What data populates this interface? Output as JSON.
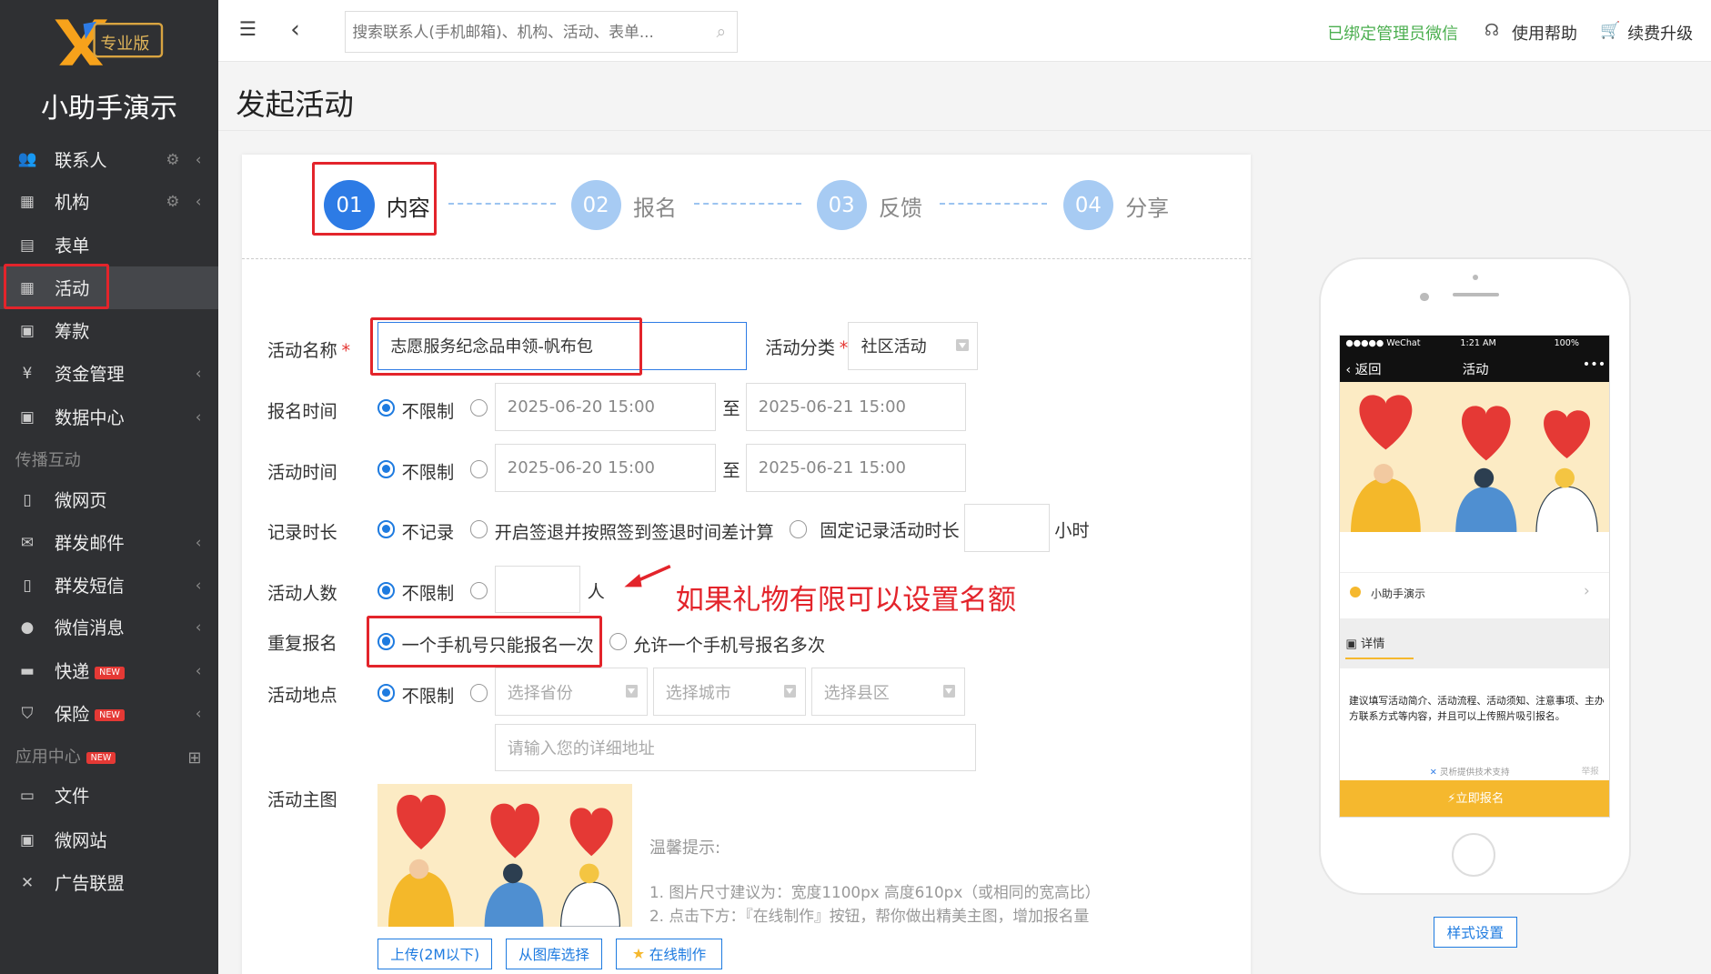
{
  "app": {
    "edition_badge": "专业版",
    "brand_name": "小助手演示"
  },
  "sidebar": {
    "items": [
      {
        "label": "联系人",
        "icon": "contacts-icon"
      },
      {
        "label": "机构",
        "icon": "building-icon"
      },
      {
        "label": "表单",
        "icon": "form-icon"
      },
      {
        "label": "活动",
        "icon": "calendar-icon"
      },
      {
        "label": "筹款",
        "icon": "fundraise-icon"
      },
      {
        "label": "资金管理",
        "icon": "yen-icon"
      },
      {
        "label": "数据中心",
        "icon": "data-icon"
      },
      {
        "label": "微网页",
        "icon": "page-icon"
      },
      {
        "label": "群发邮件",
        "icon": "mail-icon"
      },
      {
        "label": "群发短信",
        "icon": "phone-icon"
      },
      {
        "label": "微信消息",
        "icon": "wechat-icon"
      },
      {
        "label": "快递",
        "icon": "truck-icon"
      },
      {
        "label": "保险",
        "icon": "shield-icon"
      },
      {
        "label": "文件",
        "icon": "folder-icon"
      },
      {
        "label": "微网站",
        "icon": "site-icon"
      },
      {
        "label": "广告联盟",
        "icon": "ad-icon"
      }
    ],
    "section_broadcast": "传播互动",
    "section_apps": "应用中心",
    "new_badge": "NEW"
  },
  "topbar": {
    "search_placeholder": "搜索联系人(手机邮箱)、机构、活动、表单...",
    "bound_wechat": "已绑定管理员微信",
    "help": "使用帮助",
    "renew": "续费升级"
  },
  "page": {
    "title": "发起活动"
  },
  "steps": [
    {
      "num": "01",
      "label": "内容"
    },
    {
      "num": "02",
      "label": "报名"
    },
    {
      "num": "03",
      "label": "反馈"
    },
    {
      "num": "04",
      "label": "分享"
    }
  ],
  "form": {
    "name_label": "活动名称",
    "name_value": "志愿服务纪念品申领-帆布包",
    "category_label": "活动分类",
    "category_value": "社区活动",
    "reg_time_label": "报名时间",
    "unlimited": "不限制",
    "to": "至",
    "start": "2025-06-20 15:00",
    "end": "2025-06-21 15:00",
    "act_time_label": "活动时间",
    "record_label": "记录时长",
    "no_record": "不记录",
    "record_opt2": "开启签退并按照签到签退时间差计算",
    "record_opt3": "固定记录活动时长",
    "hours": "小时",
    "count_label": "活动人数",
    "people": "人",
    "annotation": "如果礼物有限可以设置名额",
    "repeat_label": "重复报名",
    "repeat_opt1": "一个手机号只能报名一次",
    "repeat_opt2": "允许一个手机号报名多次",
    "place_label": "活动地点",
    "province": "选择省份",
    "city": "选择城市",
    "district": "选择县区",
    "address_placeholder": "请输入您的详细地址",
    "image_label": "活动主图",
    "tip_title": "温馨提示:",
    "tip1": "1. 图片尺寸建议为：宽度1100px 高度610px（或相同的宽高比）",
    "tip2": "2. 点击下方：『在线制作』按钮，帮你做出精美主图，增加报名量",
    "upload_btn": "上传(2M以下)",
    "gallery_btn": "从图库选择",
    "online_btn": "在线制作"
  },
  "preview": {
    "carrier": "●●●●● WeChat",
    "time": "1:21 AM",
    "battery": "100%",
    "back": "返回",
    "title": "活动",
    "more": "•••",
    "org": "小助手演示",
    "detail_tab": "详情",
    "detail_text": "建议填写活动简介、活动流程、活动须知、注意事项、主办方联系方式等内容，并且可以上传照片吸引报名。",
    "powered": "灵析提供技术支持",
    "report": "举报",
    "signup": "⚡立即报名",
    "style_btn": "样式设置"
  },
  "colors": {
    "sidebar_bg": "#2f3033",
    "accent": "#1e7be0",
    "highlight": "#e3242b",
    "signup": "#f5b82e",
    "bound_text": "#4caf50"
  }
}
